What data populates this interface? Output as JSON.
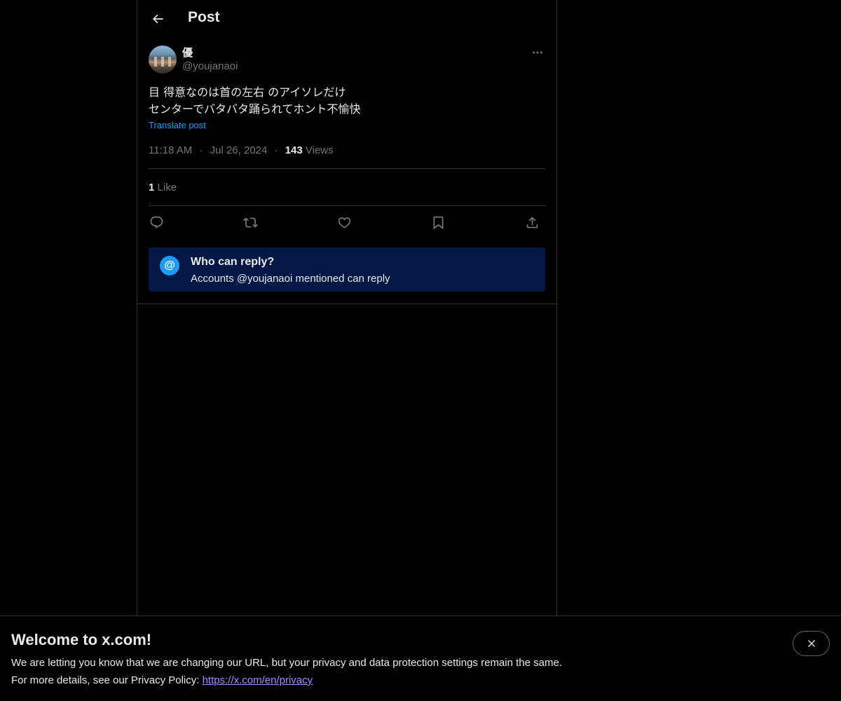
{
  "header": {
    "title": "Post",
    "back_icon": "arrow-left-icon"
  },
  "post": {
    "display_name": "優",
    "handle": "@youjanaoi",
    "text_line1": "目 得意なのは首の左右 のアイソレだけ",
    "text_line2": "センターでバタバタ踊られてホント不愉快",
    "translate_label": "Translate post",
    "time": "11:18 AM",
    "date": "Jul 26, 2024",
    "views_count": "143",
    "views_label": "Views",
    "separator": "·",
    "likes_count": "1",
    "likes_label": "Like"
  },
  "actions": [
    {
      "name": "reply",
      "icon": "reply-icon"
    },
    {
      "name": "repost",
      "icon": "repost-icon"
    },
    {
      "name": "like",
      "icon": "heart-icon"
    },
    {
      "name": "bookmark",
      "icon": "bookmark-icon"
    },
    {
      "name": "share",
      "icon": "share-icon"
    }
  ],
  "reply_restriction": {
    "badge": "@",
    "title": "Who can reply?",
    "description": "Accounts @youjanaoi mentioned can reply"
  },
  "banner": {
    "title": "Welcome to x.com!",
    "line1": "We are letting you know that we are changing our URL, but your privacy and data protection settings remain the same.",
    "line2_prefix": "For more details, see our Privacy Policy: ",
    "link_text": "https://x.com/en/privacy",
    "close_icon": "close-icon"
  },
  "colors": {
    "background": "#000000",
    "text": "#e7e9ea",
    "muted": "#71767b",
    "accent": "#1d9bf0",
    "border": "#2f3336",
    "reply_box": "#031845",
    "link": "#a18fff"
  }
}
